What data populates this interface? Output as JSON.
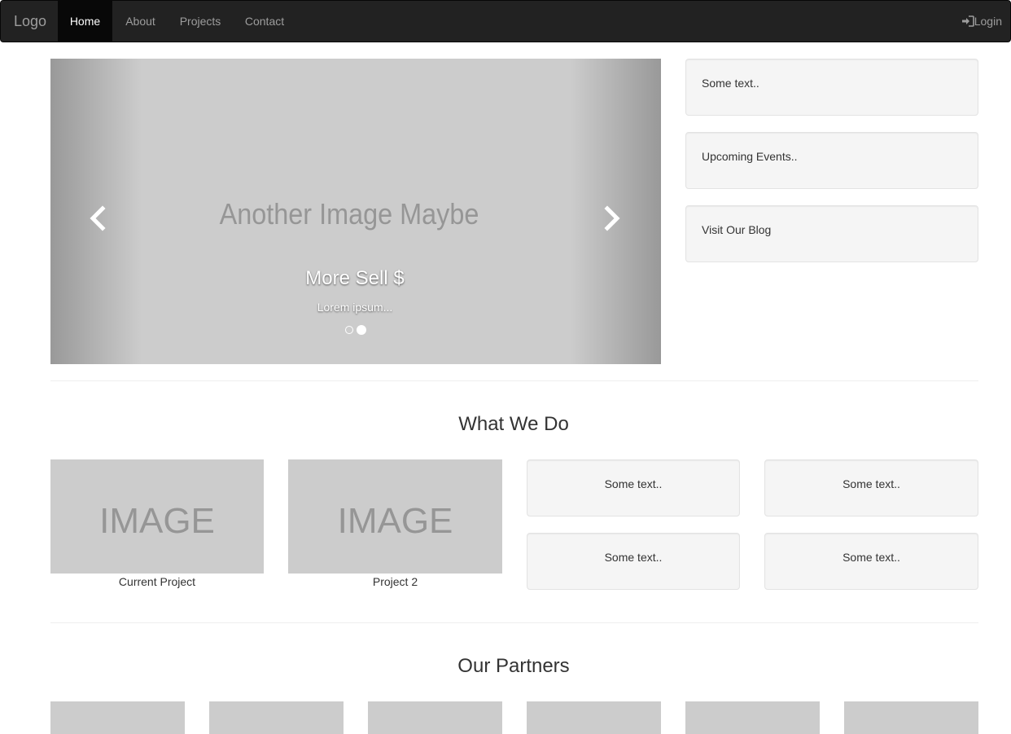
{
  "navbar": {
    "brand": "Logo",
    "items": [
      {
        "label": "Home",
        "active": true
      },
      {
        "label": "About",
        "active": false
      },
      {
        "label": "Projects",
        "active": false
      },
      {
        "label": "Contact",
        "active": false
      }
    ],
    "login_label": "Login",
    "login_icon": "log-in-icon"
  },
  "carousel": {
    "placeholder": "Another Image Maybe",
    "caption_title": "More Sell $",
    "caption_text": "Lorem ipsum...",
    "active_slide": 2,
    "slide_count": 2
  },
  "sidebar": {
    "wells": [
      "Some text..",
      "Upcoming Events..",
      "Visit Our Blog"
    ]
  },
  "what_we_do": {
    "title": "What We Do",
    "projects": [
      {
        "image_text": "IMAGE",
        "caption": "Current Project"
      },
      {
        "image_text": "IMAGE",
        "caption": "Project 2"
      }
    ],
    "wells": [
      "Some text..",
      "Some text..",
      "Some text..",
      "Some text.."
    ]
  },
  "partners": {
    "title": "Our Partners",
    "count": 6
  },
  "colors": {
    "navbar_bg": "#222222",
    "active_bg": "#080808",
    "placeholder_gray": "#cccccc",
    "well_bg": "#f5f5f5"
  }
}
